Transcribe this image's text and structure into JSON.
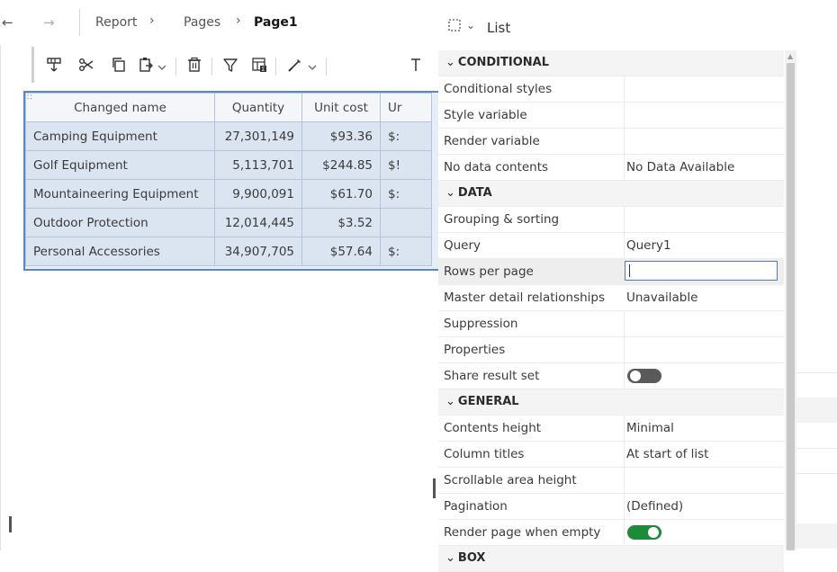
{
  "breadcrumb": {
    "items": [
      "Report",
      "Pages",
      "Page1"
    ]
  },
  "toolbar": {
    "icons": [
      "select-ancestor-icon",
      "cut-icon",
      "copy-icon",
      "paste-icon",
      "delete-icon",
      "filter-icon",
      "summarize-icon",
      "style-icon",
      "text-icon"
    ]
  },
  "list_table": {
    "columns": [
      "Changed name",
      "Quantity",
      "Unit cost",
      "Ur"
    ],
    "rows": [
      [
        "Camping Equipment",
        "27,301,149",
        "$93.36",
        "$:"
      ],
      [
        "Golf Equipment",
        "5,113,701",
        "$244.85",
        "$!"
      ],
      [
        "Mountaineering Equipment",
        "9,900,091",
        "$61.70",
        "$:"
      ],
      [
        "Outdoor Protection",
        "12,014,445",
        "$3.52",
        ""
      ],
      [
        "Personal Accessories",
        "34,907,705",
        "$57.64",
        "$:"
      ]
    ]
  },
  "panel": {
    "title": "List",
    "conditional": {
      "header": "CONDITIONAL",
      "conditional_styles": "Conditional styles",
      "style_variable": "Style variable",
      "render_variable": "Render variable",
      "no_data_contents": "No data contents",
      "no_data_contents_value": "No Data Available"
    },
    "data": {
      "header": "DATA",
      "grouping_sorting": "Grouping & sorting",
      "query": "Query",
      "query_value": "Query1",
      "rows_per_page": "Rows per page",
      "rows_per_page_value": "",
      "master_detail": "Master detail relationships",
      "master_detail_value": "Unavailable",
      "suppression": "Suppression",
      "properties": "Properties",
      "share_result_set": "Share result set",
      "share_result_set_on": false
    },
    "general": {
      "header": "GENERAL",
      "contents_height": "Contents height",
      "contents_height_value": "Minimal",
      "column_titles": "Column titles",
      "column_titles_value": "At start of list",
      "scrollable_area_height": "Scrollable area height",
      "pagination": "Pagination",
      "pagination_value": "(Defined)",
      "render_page_when_empty": "Render page when empty",
      "render_page_when_empty_on": true
    },
    "box": {
      "header": "BOX"
    }
  },
  "colors": {
    "selection_border": "#5b87c5",
    "cell_fill": "#dbe5f2",
    "toggle_on": "#1e8a3c",
    "toggle_off": "#5a5a5a",
    "input_focus": "#4a7cc3"
  }
}
